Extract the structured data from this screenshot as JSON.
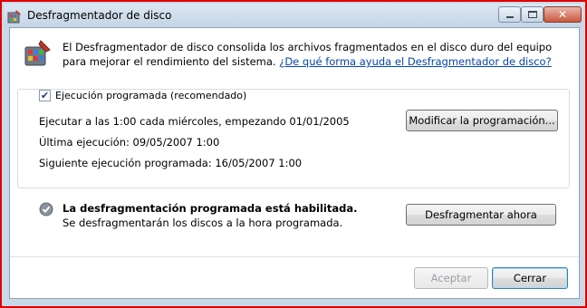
{
  "window": {
    "title": "Desfragmentador de disco",
    "close_symbol": "✕",
    "icons": {
      "app": "defrag-app-icon",
      "minimize": "minimize-icon",
      "maximize": "maximize-icon",
      "close": "close-icon"
    }
  },
  "intro": {
    "text": "El Desfragmentador de disco consolida los archivos fragmentados en el disco duro del equipo para mejorar el rendimiento del sistema. ",
    "link": "¿De qué forma ayuda el Desfragmentador de disco?",
    "icon": "defrag-icon"
  },
  "schedule": {
    "checkbox_label": "Ejecución programada (recomendado)",
    "checkbox_checked": true,
    "run_text": "Ejecutar a las 1:00 cada miércoles, empezando 01/01/2005",
    "last_run": "Última ejecución: 09/05/2007 1:00",
    "next_run": "Siguiente ejecución programada: 16/05/2007 1:00",
    "modify_button": "Modificar la programación..."
  },
  "status": {
    "icon": "check-shield-icon",
    "title": "La desfragmentación programada está habilitada.",
    "subtitle": "Se desfragmentarán los discos a la hora programada.",
    "defrag_button": "Desfragmentar ahora"
  },
  "footer": {
    "accept_button": "Aceptar",
    "close_button": "Cerrar"
  },
  "colors": {
    "frame_border": "#e00000",
    "link": "#0645ad",
    "title_bar": "#c4d5e6"
  }
}
